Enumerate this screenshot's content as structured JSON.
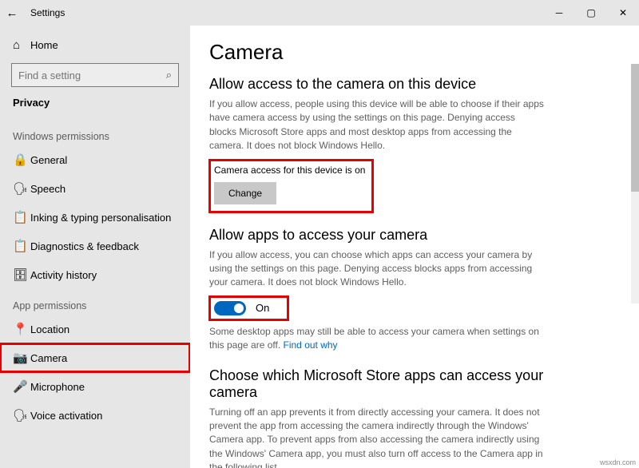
{
  "titlebar": {
    "title": "Settings"
  },
  "sidebar": {
    "home": "Home",
    "search_placeholder": "Find a setting",
    "crumb": "Privacy",
    "group_windows": "Windows permissions",
    "group_app": "App permissions",
    "items_windows": [
      "General",
      "Speech",
      "Inking & typing personalisation",
      "Diagnostics & feedback",
      "Activity history"
    ],
    "items_app": [
      "Location",
      "Camera",
      "Microphone",
      "Voice activation"
    ]
  },
  "content": {
    "h1": "Camera",
    "s1_h2": "Allow access to the camera on this device",
    "s1_p": "If you allow access, people using this device will be able to choose if their apps have camera access by using the settings on this page. Denying access blocks Microsoft Store apps and most desktop apps from accessing the camera. It does not block Windows Hello.",
    "status": "Camera access for this device is on",
    "change": "Change",
    "s2_h2": "Allow apps to access your camera",
    "s2_p": "If you allow access, you can choose which apps can access your camera by using the settings on this page. Denying access blocks apps from accessing your camera. It does not block Windows Hello.",
    "toggle_label": "On",
    "s2_p2a": "Some desktop apps may still be able to access your camera when settings on this page are off. ",
    "s2_p2_link": "Find out why",
    "s3_h2": "Choose which Microsoft Store apps can access your camera",
    "s3_p": "Turning off an app prevents it from directly accessing your camera. It does not prevent the app from accessing the camera indirectly through the Windows' Camera app. To prevent apps from also accessing the camera indirectly using the Windows' Camera app, you must also turn off access to the Camera app in the following list."
  },
  "watermark": "wsxdn.com"
}
